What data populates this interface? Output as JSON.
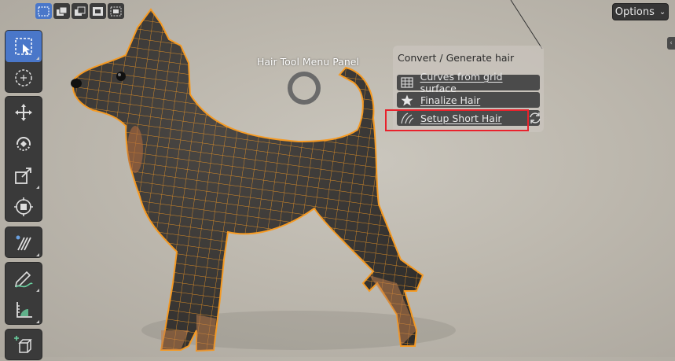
{
  "header": {
    "selection_modes": [
      "select-new-icon",
      "select-extend-icon",
      "select-subtract-icon",
      "select-invert-icon",
      "select-intersect-icon"
    ],
    "options_label": "Options"
  },
  "toolbar": {
    "tools": [
      "select-box-icon",
      "select-circle-icon",
      "move-icon",
      "rotate-icon",
      "scale-icon",
      "transform-icon",
      "comb-icon",
      "annotate-icon",
      "measure-icon",
      "add-cube-icon"
    ]
  },
  "overlay": {
    "label": "Hair Tool Menu Panel"
  },
  "menu": {
    "title": "Convert / Generate hair",
    "items": [
      {
        "label": "Curves from grid surface",
        "icon": "grid-icon"
      },
      {
        "label": "Finalize Hair",
        "icon": "star-icon"
      },
      {
        "label": "Setup Short Hair",
        "icon": "hair-curves-icon"
      }
    ]
  },
  "colors": {
    "accent": "#4a77c9",
    "wireframe": "#f59a23",
    "highlight": "#e8222c",
    "mesh": "#3c3a38"
  }
}
